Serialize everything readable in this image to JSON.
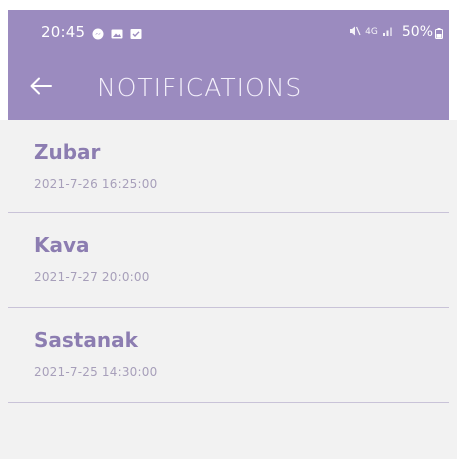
{
  "status_bar": {
    "time": "20:45",
    "network": "4G",
    "battery": "50%"
  },
  "header": {
    "title": "NOTIFICATIONS"
  },
  "notifications": [
    {
      "title": "Zubar",
      "datetime": "2021-7-26  16:25:00"
    },
    {
      "title": "Kava",
      "datetime": "2021-7-27  20:0:00"
    },
    {
      "title": "Sastanak",
      "datetime": "2021-7-25  14:30:00"
    }
  ],
  "colors": {
    "header_bg": "#9b8bbf",
    "title_text": "#8c7db1",
    "subtitle_text": "#a79fba",
    "background": "#f2f2f2",
    "divider": "#c9c3d8"
  }
}
